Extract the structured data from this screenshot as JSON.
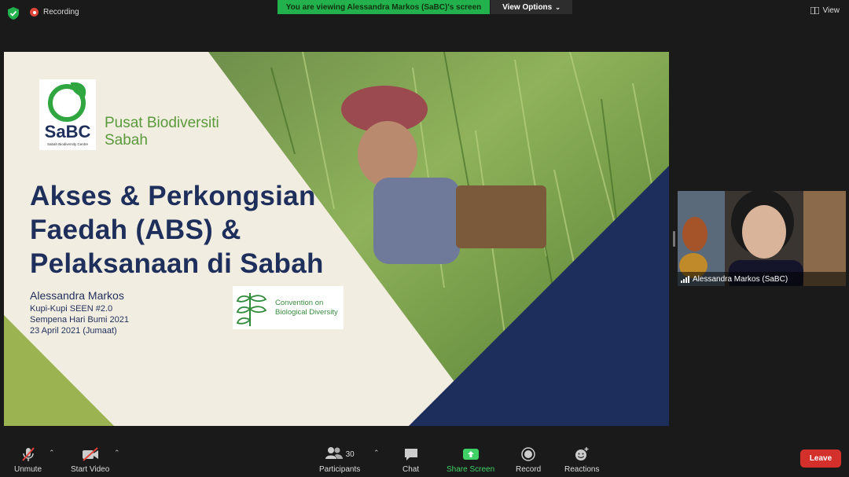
{
  "topbar": {
    "recording_label": "Recording",
    "viewing_banner": "You are viewing Alessandra Markos (SaBC)'s screen",
    "view_options_label": "View Options",
    "view_label": "View"
  },
  "slide": {
    "logo_text": "SaBC",
    "logo_subtext": "Sabah Biodiversity Centre",
    "org_name_line1": "Pusat Biodiversiti",
    "org_name_line2": "Sabah",
    "title_line1": "Akses & Perkongsian",
    "title_line2": "Faedah (ABS) &",
    "title_line3": "Pelaksanaan di Sabah",
    "author": "Alessandra Markos",
    "meta_line1": "Kupi-Kupi SEEN #2.0",
    "meta_line2": "Sempena Hari Bumi 2021",
    "meta_line3": "23 April 2021 (Jumaat)",
    "cbd_line1": "Convention on",
    "cbd_line2": "Biological Diversity"
  },
  "participant_video": {
    "name": "Alessandra Markos (SaBC)"
  },
  "toolbar": {
    "unmute": "Unmute",
    "start_video": "Start Video",
    "participants_count": "30",
    "participants": "Participants",
    "chat": "Chat",
    "share_screen": "Share Screen",
    "record": "Record",
    "reactions": "Reactions",
    "leave": "Leave"
  }
}
